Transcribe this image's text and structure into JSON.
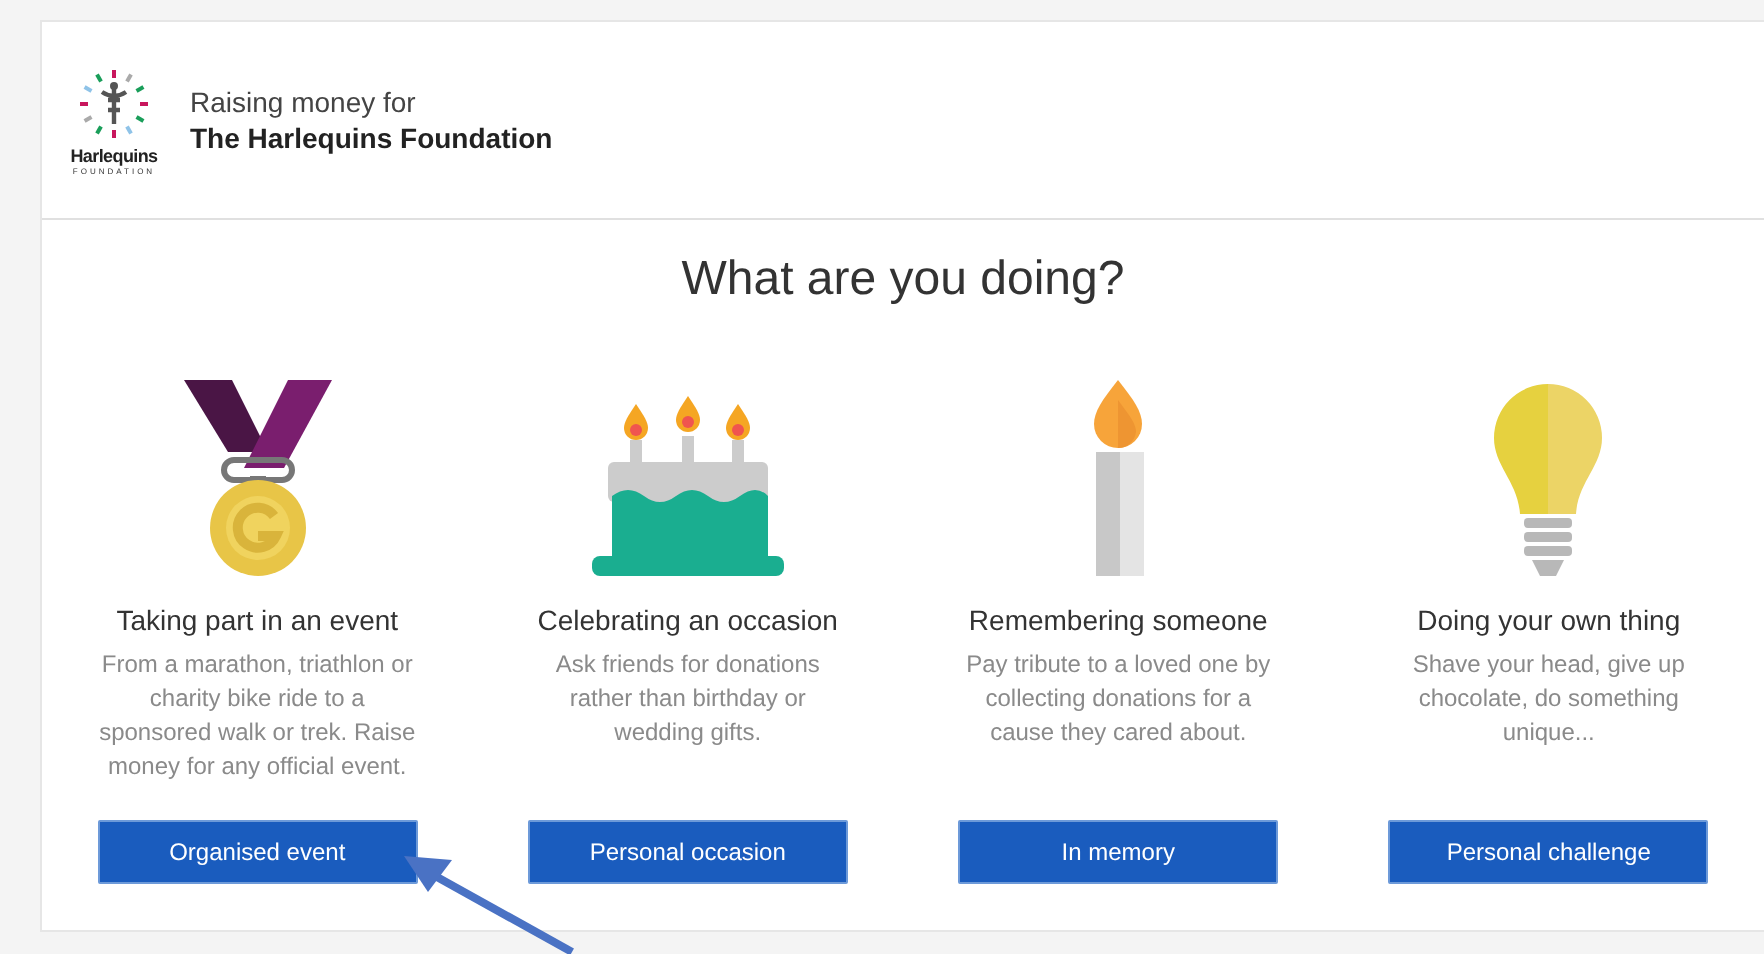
{
  "header": {
    "logo": {
      "name": "Harlequins",
      "subtitle": "FOUNDATION"
    },
    "intro": "Raising money for",
    "charity": "The Harlequins Foundation"
  },
  "title": "What are you doing?",
  "options": [
    {
      "kind": "medal",
      "heading": "Taking part in an event",
      "description": "From a marathon, triathlon or charity bike ride to a sponsored walk or trek. Raise money for any official event.",
      "button": "Organised event"
    },
    {
      "kind": "cake",
      "heading": "Celebrating an occasion",
      "description": "Ask friends for donations rather than birthday or wedding gifts.",
      "button": "Personal occasion"
    },
    {
      "kind": "candle",
      "heading": "Remembering someone",
      "description": "Pay tribute to a loved one by collecting donations for a cause they cared about.",
      "button": "In memory"
    },
    {
      "kind": "bulb",
      "heading": "Doing your own thing",
      "description": "Shave your head, give up chocolate, do something unique...",
      "button": "Personal challenge"
    }
  ]
}
